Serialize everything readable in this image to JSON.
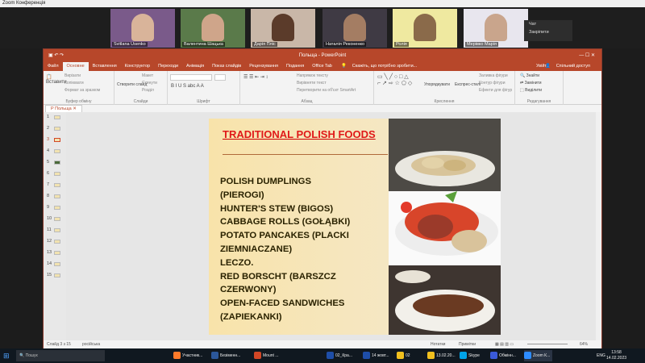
{
  "zoom": {
    "window_title": "Zoom Конференція",
    "participants": [
      "Svitlana Usenko",
      "Валентина Шацька",
      "Дарія Пліс",
      "Наталія Реконенко",
      "Ролія",
      "Мерівко Марія"
    ],
    "menu": [
      "Чат",
      "Закріпити"
    ]
  },
  "ppt": {
    "title": "Польща - PowerPoint",
    "tabs": [
      "Файл",
      "Основне",
      "Вставлення",
      "Конструктор",
      "Переходи",
      "Анімація",
      "Показ слайдів",
      "Рецензування",
      "Подання",
      "Office Tab"
    ],
    "tell_me": "Скажіть, що потрібно зробити...",
    "user": "Увійти",
    "share": "Спільний доступ",
    "ribbon": {
      "clipboard": {
        "paste": "Вставити",
        "cut": "Вирізати",
        "copy": "Копіювати",
        "format": "Формат за зразком",
        "label": "Буфер обміну"
      },
      "slides": {
        "new": "Створити слайд",
        "layout": "Макет",
        "reset": "Скинути",
        "section": "Розділ",
        "label": "Слайди"
      },
      "font": {
        "label": "Шрифт"
      },
      "paragraph": {
        "direction": "Напрямок тексту",
        "align": "Вирівняти текст",
        "smartart": "Перетворити на об'єкт SmartArt",
        "label": "Абзац"
      },
      "drawing": {
        "arrange": "Упорядкувати",
        "styles": "Експрес-стилі",
        "fill": "Заливка фігури",
        "outline": "Контур фігури",
        "effects": "Ефекти для фігур",
        "label": "Креслення"
      },
      "editing": {
        "find": "Знайти",
        "replace": "Замінити",
        "select": "Виділити",
        "label": "Редагування"
      }
    },
    "section": "Польща",
    "slides": [
      "1",
      "2",
      "3",
      "4",
      "5",
      "6",
      "7",
      "8",
      "9",
      "10",
      "11",
      "12",
      "13",
      "14",
      "15"
    ],
    "slide": {
      "title": "TRADITIONAL POLISH FOODS",
      "body": "      POLISH DUMPLINGS\n(PIEROGI)\n      HUNTER'S STEW (BIGOS)\n      CABBAGE ROLLS (GOŁĄBKI)\n      POTATO PANCAKES (PLACKI\nZIEMNIACZANE)\n      LECZO.\n      RED BORSCHT (BARSZCZ\nCZERWONY)\n      OPEN-FACED SANDWICHES\n(ZAPIEKANKI)"
    },
    "status": {
      "slide": "Слайд 3 з 15",
      "lang": "російська",
      "notes": "Нотатки",
      "comments": "Примітки",
      "zoom": "64%"
    }
  },
  "taskbar": {
    "search": "Пошук",
    "items": [
      "Участник...",
      "Безіменн...",
      "Mount ...",
      "02_Кра...",
      "14 жовт...",
      "02",
      "13.02.20...",
      "Skype",
      "Обмінн...",
      "Zoom К..."
    ],
    "lang": "ENG",
    "time": "13:58",
    "date": "14.02.2023"
  }
}
